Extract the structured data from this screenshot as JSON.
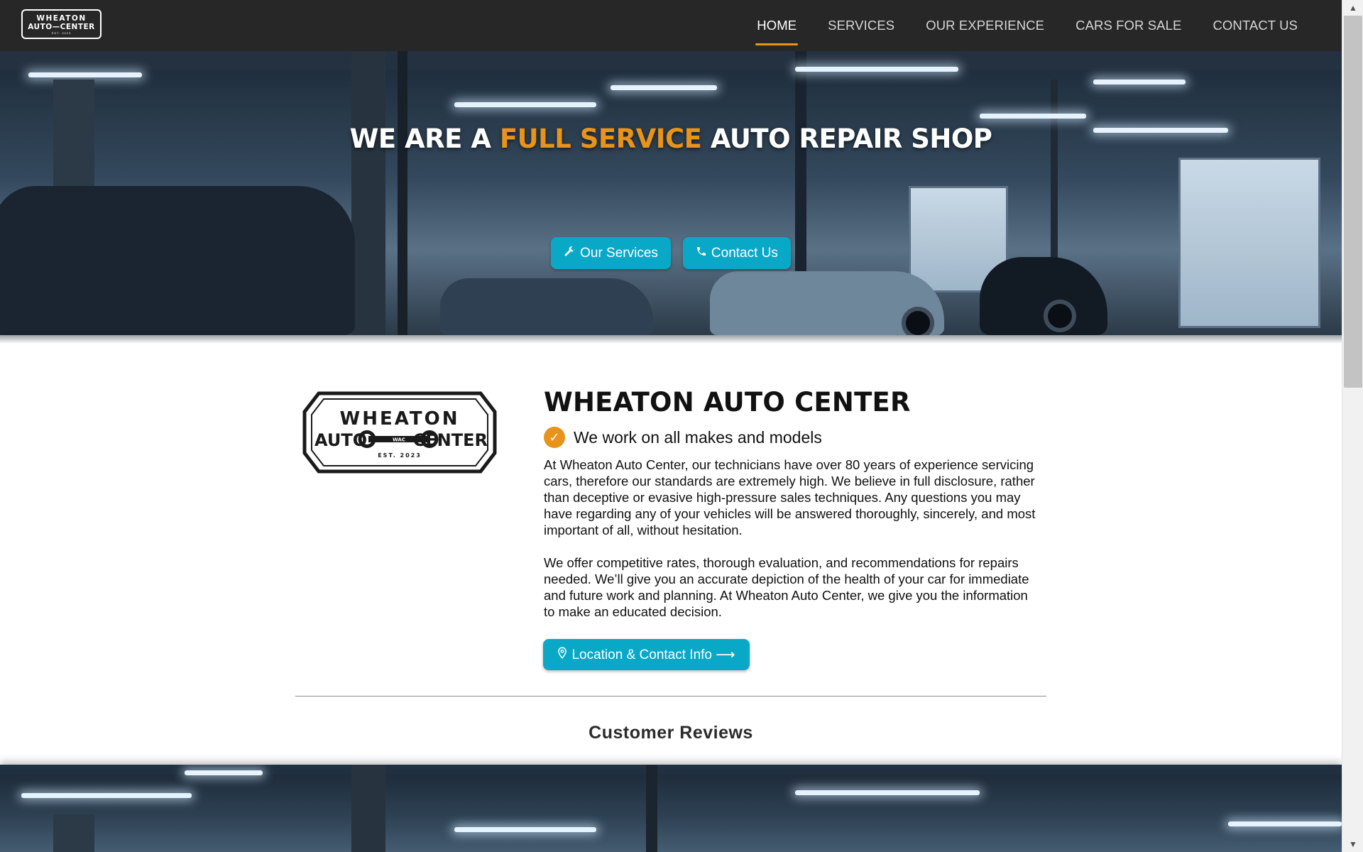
{
  "nav": {
    "logo_line1": "WHEATON",
    "logo_line2": "AUTO—CENTER",
    "logo_line3": "EST. 2023",
    "links": [
      {
        "label": "HOME",
        "active": true
      },
      {
        "label": "SERVICES"
      },
      {
        "label": "OUR EXPERIENCE"
      },
      {
        "label": "CARS FOR SALE"
      },
      {
        "label": "CONTACT US"
      }
    ]
  },
  "hero": {
    "title_pre": "WE ARE A ",
    "title_accent": "FULL SERVICE",
    "title_post": " AUTO REPAIR SHOP",
    "btn_services": "Our Services",
    "btn_contact": "Contact Us",
    "icon_services": "wrench-icon",
    "icon_contact": "phone-icon"
  },
  "about": {
    "logo_line1": "WHEATON",
    "logo_auto": "AUTO",
    "logo_center": "CENTER",
    "logo_wac": "WAC",
    "logo_est": "EST. 2023",
    "title": "WHEATON AUTO CENTER",
    "check_text": "We work on all makes and models",
    "para1": "At Wheaton Auto Center, our technicians have over 80 years of experience servicing cars, therefore our standards are extremely high. We believe in full disclosure, rather than deceptive or evasive high-pressure sales techniques. Any questions you may have regarding any of your vehicles will be answered thoroughly, sincerely, and most important of all, without hesitation.",
    "para2": "We offer competitive rates, thorough evaluation, and recommendations for repairs needed. We’ll give you an accurate depiction of the health of your car for immediate and future work and planning. At Wheaton Auto Center, we give you the information to make an educated decision.",
    "location_btn": "Location & Contact Info ⟶",
    "icon_location": "map-pin-icon"
  },
  "reviews": {
    "title": "Customer Reviews"
  },
  "colors": {
    "accent_orange": "#e8931a",
    "button_cyan": "#0aa8c7",
    "nav_bg": "#272727"
  }
}
